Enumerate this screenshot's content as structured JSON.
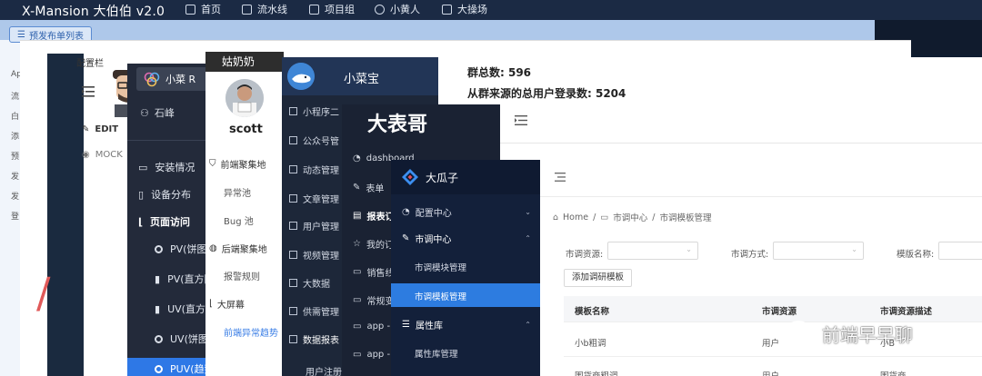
{
  "xmansion": {
    "logo": "X-Mansion 大伯伯 v2.0",
    "nav": [
      {
        "label": "首页",
        "icon": "home-icon"
      },
      {
        "label": "流水线",
        "icon": "grid-icon"
      },
      {
        "label": "项目组",
        "icon": "tree-icon"
      },
      {
        "label": "小黄人",
        "icon": "smile-icon"
      },
      {
        "label": "大操场",
        "icon": "chart-icon"
      }
    ]
  },
  "blue_layer": {
    "button_label": "预发布单列表",
    "left_list": [
      "Ap",
      "流",
      "白",
      "添",
      "预",
      "发",
      "发",
      "登"
    ]
  },
  "white_layer": {
    "config_title": "配置栏",
    "edit_label": "EDIT",
    "mock_label": "MOCK",
    "red_letter": "/"
  },
  "xiaocai": {
    "brand": "小菜 R",
    "user": "石峰",
    "items": [
      "安装情况",
      "设备分布",
      "页面访问"
    ],
    "sub_items": [
      "PV(饼图)",
      "PV(直方图",
      "UV(直方图",
      "UV(饼图)",
      "PUV(趋势"
    ]
  },
  "gunainai": {
    "header": "姑奶奶",
    "name": "scott",
    "groups": [
      {
        "label": "前端聚集地",
        "subs": [
          "异常池",
          "Bug 池"
        ]
      },
      {
        "label": "后端聚集地",
        "subs": [
          "报警规则"
        ]
      },
      {
        "label": "大屏幕",
        "subs": [
          "前端异常趋势"
        ]
      }
    ]
  },
  "xiaocaibao": {
    "title": "小菜宝",
    "items": [
      "小程序二",
      "公众号管",
      "动态管理",
      "文章管理",
      "用户管理",
      "视频管理",
      "大数据",
      "供需管理",
      "数据报表",
      "用户注册"
    ],
    "info_group_count": "群总数: 596",
    "info_login_count": "从群来源的总用户登录数: 5204"
  },
  "dabiaoge": {
    "title": "大表哥",
    "items": [
      "dashboard",
      "表单",
      "报表订",
      "我的订",
      "销售线",
      "常规变",
      "app -",
      "app -"
    ]
  },
  "daguazi": {
    "title": "大瓜子",
    "menu": [
      {
        "label": "配置中心",
        "arrow": "⌄"
      },
      {
        "label": "市调中心",
        "arrow": "⌃"
      }
    ],
    "sub_items": [
      "市调模块管理",
      "市调模板管理"
    ],
    "attr_menu": {
      "label": "属性库",
      "arrow": "⌃"
    },
    "attr_sub": "属性库管理",
    "breadcrumb": [
      "Home",
      "市调中心",
      "市调模板管理"
    ],
    "filters": {
      "source_label": "市调资源:",
      "method_label": "市调方式:",
      "template_label": "模版名称:"
    },
    "add_button": "添加调研模板",
    "table": {
      "headers": [
        "模板名称",
        "市调资源",
        "市调资源描述"
      ],
      "rows": [
        [
          "小b粗调",
          "用户",
          "小B"
        ],
        [
          "围货商粗调",
          "用户",
          "围货商"
        ]
      ]
    }
  },
  "watermark": "前端早早聊",
  "colors": {
    "active_blue": "#2e78e6",
    "dark_sidebar": "#1d2739",
    "accent_link": "#3a7ee6"
  }
}
